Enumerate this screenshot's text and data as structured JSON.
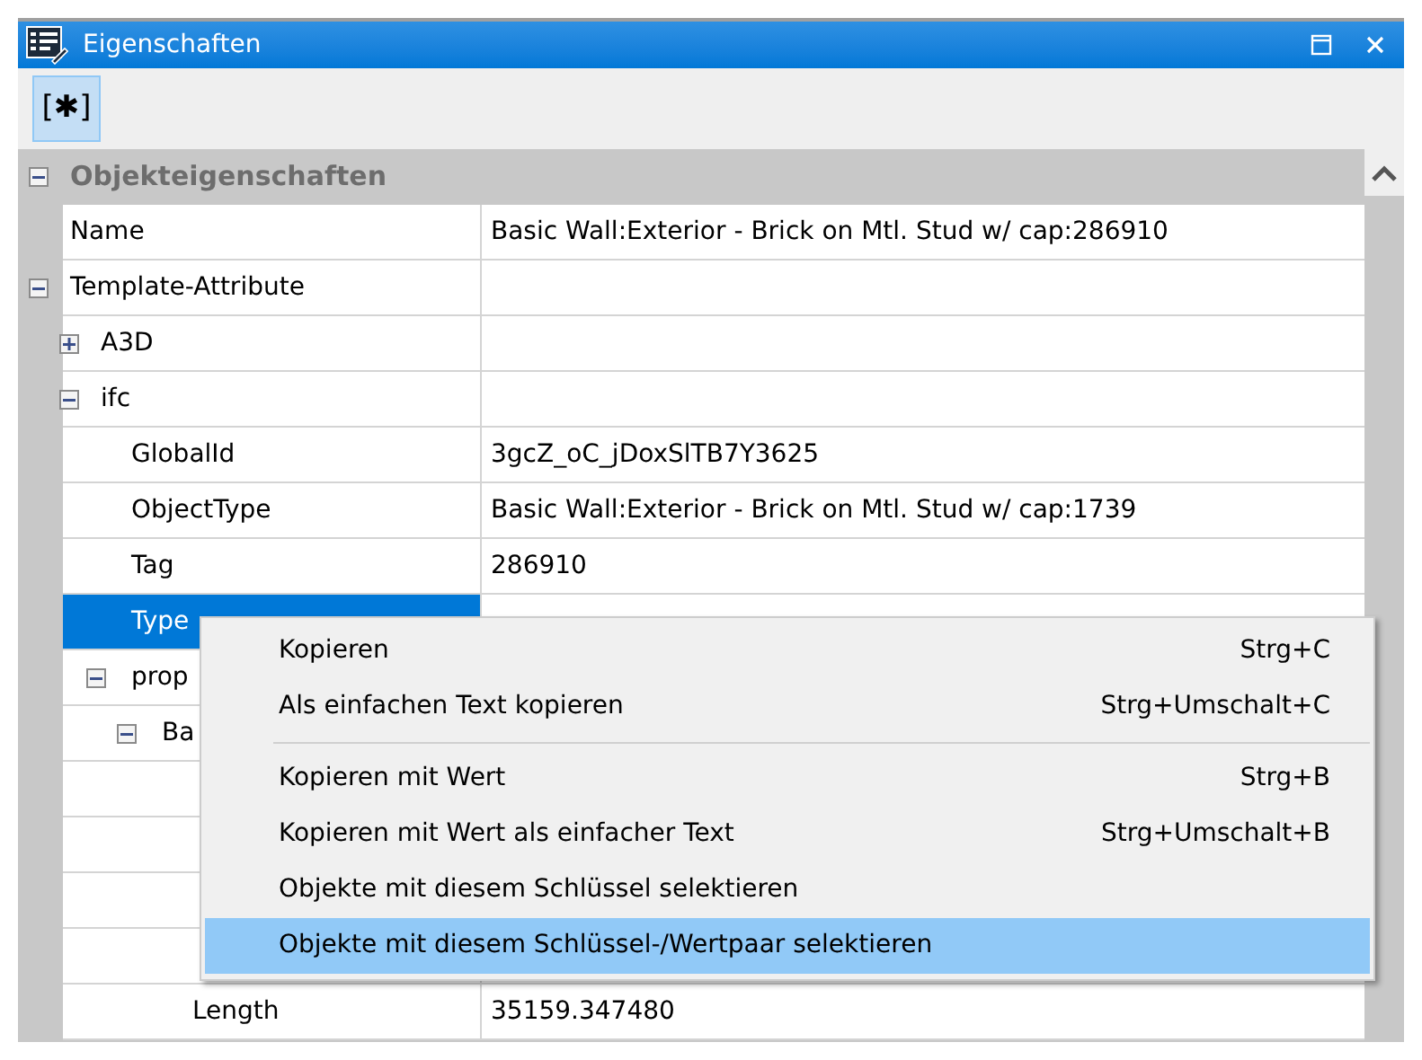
{
  "window": {
    "title": "Eigenschaften"
  },
  "toolbar": {
    "button": "[✱]",
    "selected": true
  },
  "grid": {
    "sections": [
      {
        "title": "Objekteigenschaften",
        "expanded": true,
        "children": [
          {
            "name": "Name",
            "value": "Basic Wall:Exterior - Brick on Mtl. Stud w/ cap:286910",
            "selected": false
          },
          {
            "name": "Template-Attribute",
            "expanded": true,
            "selected": false,
            "children": [
              {
                "name": "A3D",
                "expanded": false,
                "selected": false
              },
              {
                "name": "ifc",
                "expanded": true,
                "selected": false,
                "children": [
                  {
                    "name": "GlobalId",
                    "value": "3gcZ_oC_jDoxSlTB7Y3625",
                    "selected": false
                  },
                  {
                    "name": "ObjectType",
                    "value": "Basic Wall:Exterior - Brick on Mtl. Stud w/ cap:1739",
                    "selected": false
                  },
                  {
                    "name": "Tag",
                    "value": "286910",
                    "selected": false
                  },
                  {
                    "name": "Type",
                    "selected": true
                  },
                  {
                    "name": "prop",
                    "expanded": true,
                    "selected": false,
                    "children": [
                      {
                        "name": "Ba",
                        "expanded": true,
                        "selected": false,
                        "children": [
                          {
                            "selected": false
                          },
                          {
                            "selected": false
                          },
                          {
                            "selected": false
                          },
                          {
                            "selected": false
                          },
                          {
                            "name": "Length",
                            "value": "35159.347480",
                            "selected": false
                          }
                        ]
                      }
                    ]
                  }
                ]
              }
            ]
          }
        ]
      }
    ]
  },
  "context_menu": {
    "items": [
      {
        "kind": "item",
        "label": "Kopieren",
        "shortcut": "Strg+C",
        "selected": false
      },
      {
        "kind": "item",
        "label": "Als einfachen Text kopieren",
        "shortcut": "Strg+Umschalt+C",
        "selected": false
      },
      {
        "kind": "separator"
      },
      {
        "kind": "item",
        "label": "Kopieren mit Wert",
        "shortcut": "Strg+B",
        "selected": false
      },
      {
        "kind": "item",
        "label": "Kopieren mit Wert als einfacher Text",
        "shortcut": "Strg+Umschalt+B",
        "selected": false
      },
      {
        "kind": "item",
        "label": "Objekte mit diesem Schlüssel selektieren",
        "selected": false
      },
      {
        "kind": "item",
        "label": "Objekte mit diesem Schlüssel-/Wertpaar selektieren",
        "selected": true
      }
    ]
  }
}
